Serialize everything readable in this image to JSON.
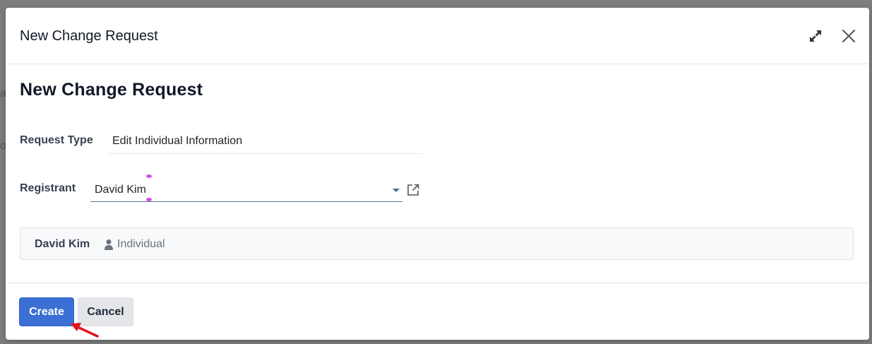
{
  "modal": {
    "title": "New Change Request",
    "header_icons": [
      "expand-icon",
      "close-icon"
    ]
  },
  "form": {
    "title": "New Change Request",
    "request_type": {
      "label": "Request Type",
      "value": "Edit Individual Information"
    },
    "registrant": {
      "label": "Registrant",
      "value": "David Kim",
      "icons": [
        "dropdown-caret-icon",
        "external-link-icon"
      ]
    },
    "info_card": {
      "name": "David Kim",
      "type": "Individual",
      "icon": "user-icon"
    }
  },
  "footer": {
    "create_label": "Create",
    "cancel_label": "Cancel"
  },
  "colors": {
    "primary": "#3b6fd4",
    "annotation_arrow": "#e3121c",
    "caret_handle": "#d04fe8"
  }
}
